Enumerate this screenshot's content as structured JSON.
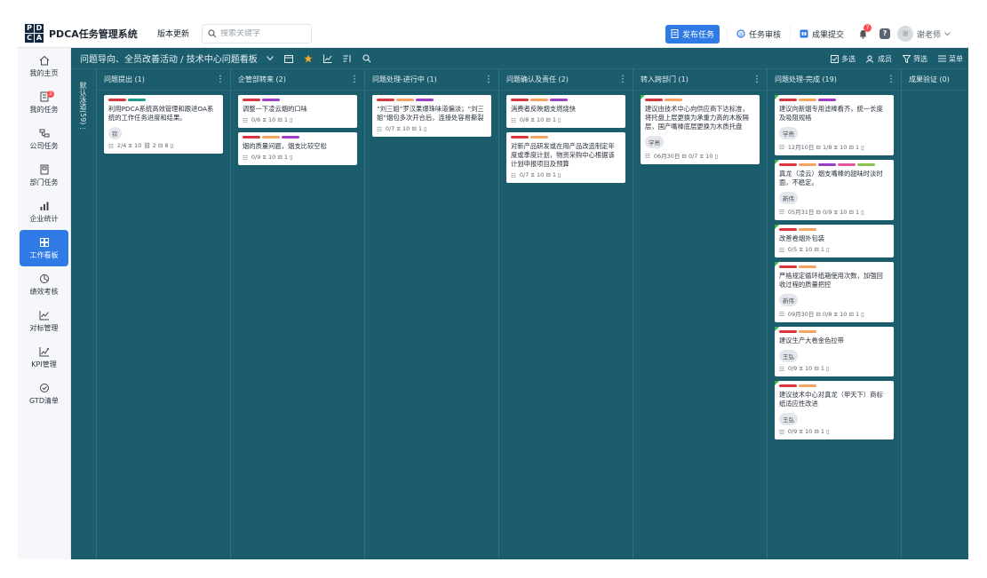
{
  "app": {
    "logo": [
      "P",
      "D",
      "C",
      "A"
    ],
    "title": "PDCA任务管理系统",
    "version_label": "版本更新",
    "search_placeholder": "搜索关键字"
  },
  "header": {
    "publish_label": "发布任务",
    "review_label": "任务审核",
    "submit_label": "成果提交",
    "notify_count": "7",
    "help_label": "?",
    "user_name": "谢老师",
    "user_avatar": "谢"
  },
  "sidebar": {
    "items": [
      {
        "label": "我的主页",
        "icon": "home-icon"
      },
      {
        "label": "我的任务",
        "icon": "task-icon",
        "badge": "2"
      },
      {
        "label": "公司任务",
        "icon": "company-icon"
      },
      {
        "label": "部门任务",
        "icon": "department-icon"
      },
      {
        "label": "企业统计",
        "icon": "bar-chart-icon"
      },
      {
        "label": "工作看板",
        "icon": "board-icon",
        "active": true
      },
      {
        "label": "绩效考核",
        "icon": "performance-icon"
      },
      {
        "label": "对标管理",
        "icon": "line-chart-icon"
      },
      {
        "label": "KPI管理",
        "icon": "kpi-icon"
      },
      {
        "label": "GTD清单",
        "icon": "gtd-icon"
      }
    ]
  },
  "board": {
    "breadcrumb": "问题导向、全员改善活动 / 技术中心问题看板",
    "actions": {
      "multi": "多选",
      "members": "成员",
      "filter": "筛选",
      "menu": "菜单"
    },
    "collapsed_col": "默认泳道(59)",
    "columns": [
      {
        "title": "问题提出 (1)",
        "cards": [
          {
            "tags": [
              "#d9363e",
              "#1f9b8e"
            ],
            "title": "利用PDCA系统高效管理和跟进OA系统的工作任务进度和结果。",
            "owner": "钦",
            "meta": "2/4 ⧖ 10 ⛓ 2 ⊟ 8 ▯"
          }
        ]
      },
      {
        "title": "企管部转来 (2)",
        "cards": [
          {
            "tags": [
              "#d9363e",
              "#9b3fc9"
            ],
            "title": "调整一下凌云烟的口味",
            "meta": "0/6 ⧖ 10 ⊟ 1 ▯"
          },
          {
            "tags": [
              "#d9363e",
              "#f4a460",
              "#9b3fc9"
            ],
            "title": "烟的质量问题，烟支比较空松",
            "meta": "0/9 ⧖ 10 ⊟ 1 ▯"
          }
        ]
      },
      {
        "title": "问题处理-进行中 (1)",
        "cards": [
          {
            "tags": [
              "#d9363e",
              "#f4a460",
              "#9b3fc9"
            ],
            "title": "“刘三姐”罗汉果爆珠味道偏淡；“刘三姐”烟包多次开合后，连接处容易撕裂",
            "meta": "0/7 ⧖ 10 ⊟ 1 ▯"
          }
        ]
      },
      {
        "title": "问题确认及责任 (2)",
        "cards": [
          {
            "tags": [
              "#d9363e",
              "#f4a460",
              "#9b3fc9"
            ],
            "title": "消费者反映烟支燃烧快",
            "meta": "0/8 ⧖ 10 ⊟ 1 ▯"
          },
          {
            "tags": [
              "#d9363e",
              "#f4a460"
            ],
            "title": "对新产品研发或在用产品改造制定年度或季度计划，物资采购中心根据该计划申报项目及预算",
            "meta": "0/7 ⧖ 10 ⊟ 1 ▯"
          }
        ]
      },
      {
        "title": "转入跨部门 (1)",
        "cards": [
          {
            "done": true,
            "tags": [
              "#d9363e",
              "#f4a460"
            ],
            "title": "建议由技术中心向供应商下达标准，将托盘上层更换为承重力高的木板隔层，国产嘴棒底层更换为木质托盘",
            "owner": "学亮",
            "meta": "06月30日 ⊟ 0/7 ⧖ 10 ▯"
          }
        ]
      },
      {
        "title": "问题处理-完成 (19)",
        "cards": [
          {
            "done": true,
            "tags": [
              "#d9363e",
              "#f4a460",
              "#9b3fc9"
            ],
            "title": "建议向新烟专用滤棒看齐，统一长度及吸阻规格",
            "owner": "学亮",
            "meta": "12月10日 ⊟ 1/8 ⧖ 10 ⊟ 1 ▯"
          },
          {
            "done": true,
            "tags": [
              "#d9363e",
              "#f4a460",
              "#9b3fc9",
              "#e056a0",
              "#8bc34a"
            ],
            "title": "真龙（凌云）烟支嘴棒的甜味时淡时面，不稳定。",
            "owner": "新伟",
            "meta": "05月31日 ⊟ 0/9 ⧖ 10 ⊟ 1 ▯"
          },
          {
            "done": true,
            "tags": [
              "#d9363e",
              "#f4a460"
            ],
            "title": "改善卷烟外包装",
            "meta": "0/5 ⧖ 10 ⊟ 1 ▯"
          },
          {
            "done": true,
            "tags": [
              "#d9363e",
              "#f4a460"
            ],
            "title": "严格规定循环纸箱使用次数，加强回收过程的质量把控",
            "owner": "新伟",
            "meta": "09月30日 ⊟ 0/8 ⧖ 10 ⊟ 1 ▯"
          },
          {
            "done": true,
            "tags": [
              "#d9363e",
              "#f4a460"
            ],
            "title": "建议生产大卷金色拉带",
            "owner": "王弘",
            "meta": "0/9 ⧖ 10 ⊟ 1 ▯"
          },
          {
            "done": true,
            "tags": [
              "#d9363e",
              "#f4a460"
            ],
            "title": "建议技术中心对真龙（甲天下）商标纸适应性改进",
            "owner": "王弘",
            "meta": "0/9 ⧖ 10 ⊟ 1 ▯"
          }
        ]
      },
      {
        "title": "成果验证 (0)",
        "cards": []
      }
    ]
  }
}
